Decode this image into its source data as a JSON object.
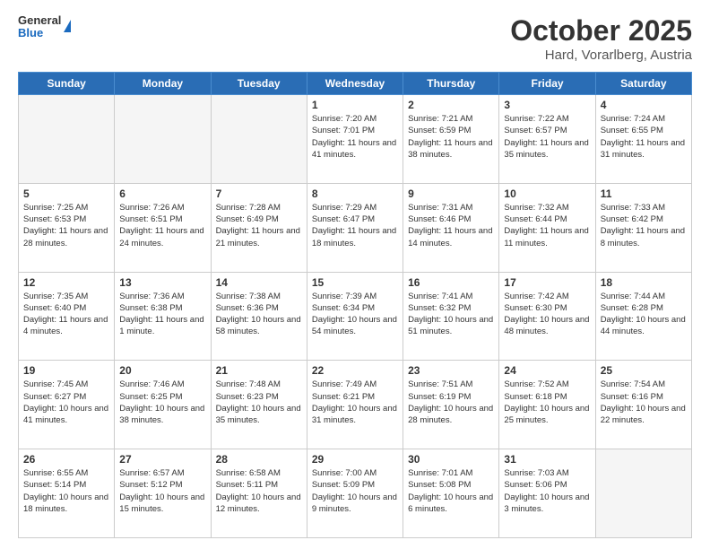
{
  "header": {
    "logo_general": "General",
    "logo_blue": "Blue",
    "title": "October 2025",
    "subtitle": "Hard, Vorarlberg, Austria"
  },
  "days_of_week": [
    "Sunday",
    "Monday",
    "Tuesday",
    "Wednesday",
    "Thursday",
    "Friday",
    "Saturday"
  ],
  "weeks": [
    [
      {
        "day": "",
        "info": ""
      },
      {
        "day": "",
        "info": ""
      },
      {
        "day": "",
        "info": ""
      },
      {
        "day": "1",
        "info": "Sunrise: 7:20 AM\nSunset: 7:01 PM\nDaylight: 11 hours and 41 minutes."
      },
      {
        "day": "2",
        "info": "Sunrise: 7:21 AM\nSunset: 6:59 PM\nDaylight: 11 hours and 38 minutes."
      },
      {
        "day": "3",
        "info": "Sunrise: 7:22 AM\nSunset: 6:57 PM\nDaylight: 11 hours and 35 minutes."
      },
      {
        "day": "4",
        "info": "Sunrise: 7:24 AM\nSunset: 6:55 PM\nDaylight: 11 hours and 31 minutes."
      }
    ],
    [
      {
        "day": "5",
        "info": "Sunrise: 7:25 AM\nSunset: 6:53 PM\nDaylight: 11 hours and 28 minutes."
      },
      {
        "day": "6",
        "info": "Sunrise: 7:26 AM\nSunset: 6:51 PM\nDaylight: 11 hours and 24 minutes."
      },
      {
        "day": "7",
        "info": "Sunrise: 7:28 AM\nSunset: 6:49 PM\nDaylight: 11 hours and 21 minutes."
      },
      {
        "day": "8",
        "info": "Sunrise: 7:29 AM\nSunset: 6:47 PM\nDaylight: 11 hours and 18 minutes."
      },
      {
        "day": "9",
        "info": "Sunrise: 7:31 AM\nSunset: 6:46 PM\nDaylight: 11 hours and 14 minutes."
      },
      {
        "day": "10",
        "info": "Sunrise: 7:32 AM\nSunset: 6:44 PM\nDaylight: 11 hours and 11 minutes."
      },
      {
        "day": "11",
        "info": "Sunrise: 7:33 AM\nSunset: 6:42 PM\nDaylight: 11 hours and 8 minutes."
      }
    ],
    [
      {
        "day": "12",
        "info": "Sunrise: 7:35 AM\nSunset: 6:40 PM\nDaylight: 11 hours and 4 minutes."
      },
      {
        "day": "13",
        "info": "Sunrise: 7:36 AM\nSunset: 6:38 PM\nDaylight: 11 hours and 1 minute."
      },
      {
        "day": "14",
        "info": "Sunrise: 7:38 AM\nSunset: 6:36 PM\nDaylight: 10 hours and 58 minutes."
      },
      {
        "day": "15",
        "info": "Sunrise: 7:39 AM\nSunset: 6:34 PM\nDaylight: 10 hours and 54 minutes."
      },
      {
        "day": "16",
        "info": "Sunrise: 7:41 AM\nSunset: 6:32 PM\nDaylight: 10 hours and 51 minutes."
      },
      {
        "day": "17",
        "info": "Sunrise: 7:42 AM\nSunset: 6:30 PM\nDaylight: 10 hours and 48 minutes."
      },
      {
        "day": "18",
        "info": "Sunrise: 7:44 AM\nSunset: 6:28 PM\nDaylight: 10 hours and 44 minutes."
      }
    ],
    [
      {
        "day": "19",
        "info": "Sunrise: 7:45 AM\nSunset: 6:27 PM\nDaylight: 10 hours and 41 minutes."
      },
      {
        "day": "20",
        "info": "Sunrise: 7:46 AM\nSunset: 6:25 PM\nDaylight: 10 hours and 38 minutes."
      },
      {
        "day": "21",
        "info": "Sunrise: 7:48 AM\nSunset: 6:23 PM\nDaylight: 10 hours and 35 minutes."
      },
      {
        "day": "22",
        "info": "Sunrise: 7:49 AM\nSunset: 6:21 PM\nDaylight: 10 hours and 31 minutes."
      },
      {
        "day": "23",
        "info": "Sunrise: 7:51 AM\nSunset: 6:19 PM\nDaylight: 10 hours and 28 minutes."
      },
      {
        "day": "24",
        "info": "Sunrise: 7:52 AM\nSunset: 6:18 PM\nDaylight: 10 hours and 25 minutes."
      },
      {
        "day": "25",
        "info": "Sunrise: 7:54 AM\nSunset: 6:16 PM\nDaylight: 10 hours and 22 minutes."
      }
    ],
    [
      {
        "day": "26",
        "info": "Sunrise: 6:55 AM\nSunset: 5:14 PM\nDaylight: 10 hours and 18 minutes."
      },
      {
        "day": "27",
        "info": "Sunrise: 6:57 AM\nSunset: 5:12 PM\nDaylight: 10 hours and 15 minutes."
      },
      {
        "day": "28",
        "info": "Sunrise: 6:58 AM\nSunset: 5:11 PM\nDaylight: 10 hours and 12 minutes."
      },
      {
        "day": "29",
        "info": "Sunrise: 7:00 AM\nSunset: 5:09 PM\nDaylight: 10 hours and 9 minutes."
      },
      {
        "day": "30",
        "info": "Sunrise: 7:01 AM\nSunset: 5:08 PM\nDaylight: 10 hours and 6 minutes."
      },
      {
        "day": "31",
        "info": "Sunrise: 7:03 AM\nSunset: 5:06 PM\nDaylight: 10 hours and 3 minutes."
      },
      {
        "day": "",
        "info": ""
      }
    ]
  ]
}
